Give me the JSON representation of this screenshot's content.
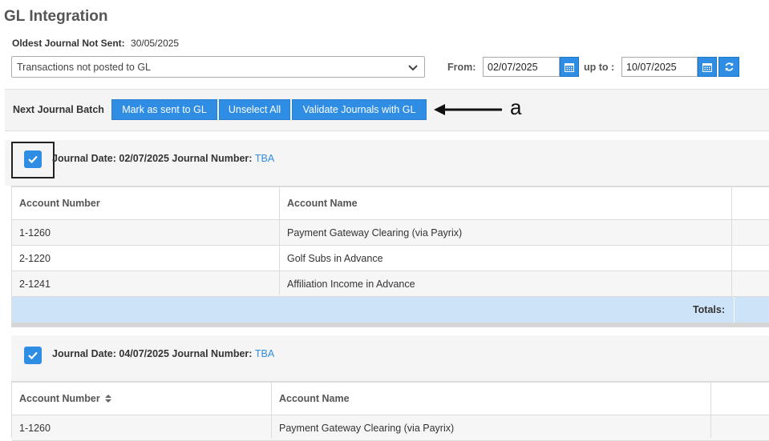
{
  "page": {
    "title": "GL Integration",
    "oldest_label": "Oldest Journal Not Sent:",
    "oldest_value": "30/05/2025"
  },
  "filter": {
    "selected": "Transactions not posted to GL",
    "from_label": "From:",
    "from_value": "02/07/2025",
    "upto_label": "up to :",
    "upto_value": "10/07/2025"
  },
  "toolbar": {
    "label": "Next Journal Batch",
    "mark_sent": "Mark as sent to GL",
    "unselect_all": "Unselect All",
    "validate": "Validate Journals with GL"
  },
  "annotation": {
    "letter": "a"
  },
  "journals": [
    {
      "date_label": "Journal Date:",
      "date": "02/07/2025",
      "number_label": "Journal Number:",
      "number": "TBA",
      "columns": [
        "Account Number",
        "Account Name"
      ],
      "rows": [
        {
          "number": "1-1260",
          "name": "Payment Gateway Clearing (via Payrix)"
        },
        {
          "number": "2-1220",
          "name": "Golf Subs in Advance"
        },
        {
          "number": "2-1241",
          "name": "Affiliation Income in Advance"
        }
      ],
      "totals_label": "Totals:"
    },
    {
      "date_label": "Journal Date:",
      "date": "04/07/2025",
      "number_label": "Journal Number:",
      "number": "TBA",
      "columns": [
        "Account Number",
        "Account Name"
      ],
      "rows": [
        {
          "number": "1-1260",
          "name": "Payment Gateway Clearing (via Payrix)"
        }
      ]
    }
  ],
  "icons": {
    "select_chevron": "chevron-down-icon",
    "calendar": "calendar-icon",
    "refresh": "refresh-icon",
    "checkbox": "check-icon",
    "sort": "sort-icon"
  },
  "colors": {
    "accent": "#2f8de4",
    "totals_row": "#cde3f8",
    "link": "#2f8de4"
  }
}
